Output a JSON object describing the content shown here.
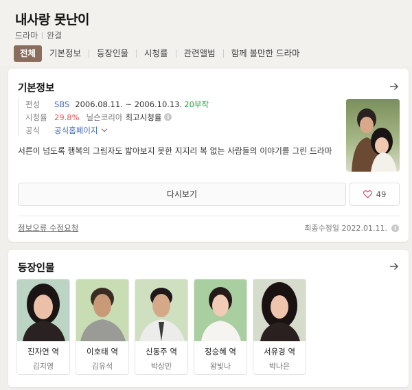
{
  "header": {
    "title": "내사랑 못난이",
    "genre": "드라마",
    "status": "완결",
    "tabs": [
      {
        "label": "전체",
        "active": true
      },
      {
        "label": "기본정보",
        "active": false
      },
      {
        "label": "등장인물",
        "active": false
      },
      {
        "label": "시청률",
        "active": false
      },
      {
        "label": "관련앨범",
        "active": false
      },
      {
        "label": "함께 볼만한 드라마",
        "active": false
      }
    ]
  },
  "info": {
    "section_title": "기본정보",
    "rows": {
      "broadcast_label": "편성",
      "channel": "SBS",
      "period": "2006.08.11. ~ 2006.10.13.",
      "episodes": "20부작",
      "rating_label": "시청률",
      "rating": "29.8%",
      "rating_source": "닐슨코리아",
      "rating_type": "최고시청률",
      "official_label": "공식",
      "official_link": "공식홈페이지"
    },
    "description": "서른이 넘도록 행복의 그림자도 밟아보지 못한 지지리 복 없는 사람들의 이야기를 그린 드라마",
    "rewatch_label": "다시보기",
    "like_count": "49",
    "report_label": "정보오류 수정요청",
    "modified_label": "최종수정일 2022.01.11."
  },
  "cast": {
    "section_title": "등장인물",
    "members": [
      {
        "role": "진자연 역",
        "actor": "김지영"
      },
      {
        "role": "이호태 역",
        "actor": "김유석"
      },
      {
        "role": "신동주 역",
        "actor": "박상민"
      },
      {
        "role": "정승혜 역",
        "actor": "왕빛나"
      },
      {
        "role": "서유경 역",
        "actor": "박나은"
      }
    ]
  },
  "colors": {
    "accent": "#8a6d5d",
    "link": "#4a6db5",
    "episodes": "#24a148",
    "rating": "#e05a5a"
  }
}
